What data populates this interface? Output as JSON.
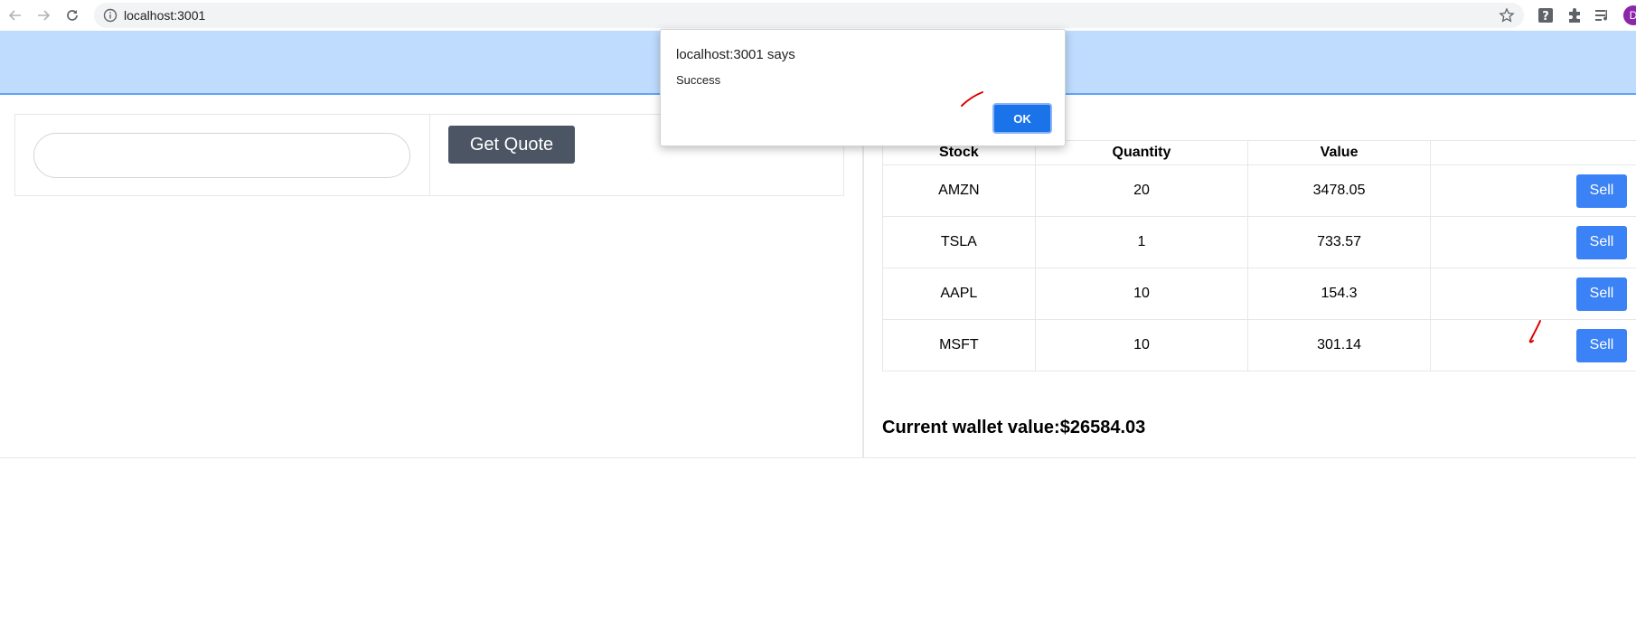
{
  "browser": {
    "url": "localhost:3001",
    "avatar_letter": "D",
    "icons": [
      "back-arrow-icon",
      "forward-arrow-icon",
      "reload-icon",
      "info-icon",
      "star-icon",
      "help-extension-icon",
      "puzzle-extension-icon",
      "media-queue-icon"
    ]
  },
  "quote": {
    "input_value": "",
    "button_label": "Get Quote"
  },
  "holdings": {
    "headers": {
      "stock": "Stock",
      "quantity": "Quantity",
      "value": "Value",
      "action": ""
    },
    "rows": [
      {
        "stock": "AMZN",
        "quantity": "20",
        "value": "3478.05",
        "action": "Sell"
      },
      {
        "stock": "TSLA",
        "quantity": "1",
        "value": "733.57",
        "action": "Sell"
      },
      {
        "stock": "AAPL",
        "quantity": "10",
        "value": "154.3",
        "action": "Sell"
      },
      {
        "stock": "MSFT",
        "quantity": "10",
        "value": "301.14",
        "action": "Sell"
      }
    ]
  },
  "wallet": {
    "text": "Current wallet value:$26584.03"
  },
  "dialog": {
    "title": "localhost:3001 says",
    "message": "Success",
    "ok_label": "OK"
  },
  "colors": {
    "header_bg": "#bfdbfe",
    "header_border": "#60a5fa",
    "quote_button": "#4b5563",
    "sell_button": "#3b82f6",
    "ok_button": "#1a73e8",
    "annotation": "#e00000"
  }
}
